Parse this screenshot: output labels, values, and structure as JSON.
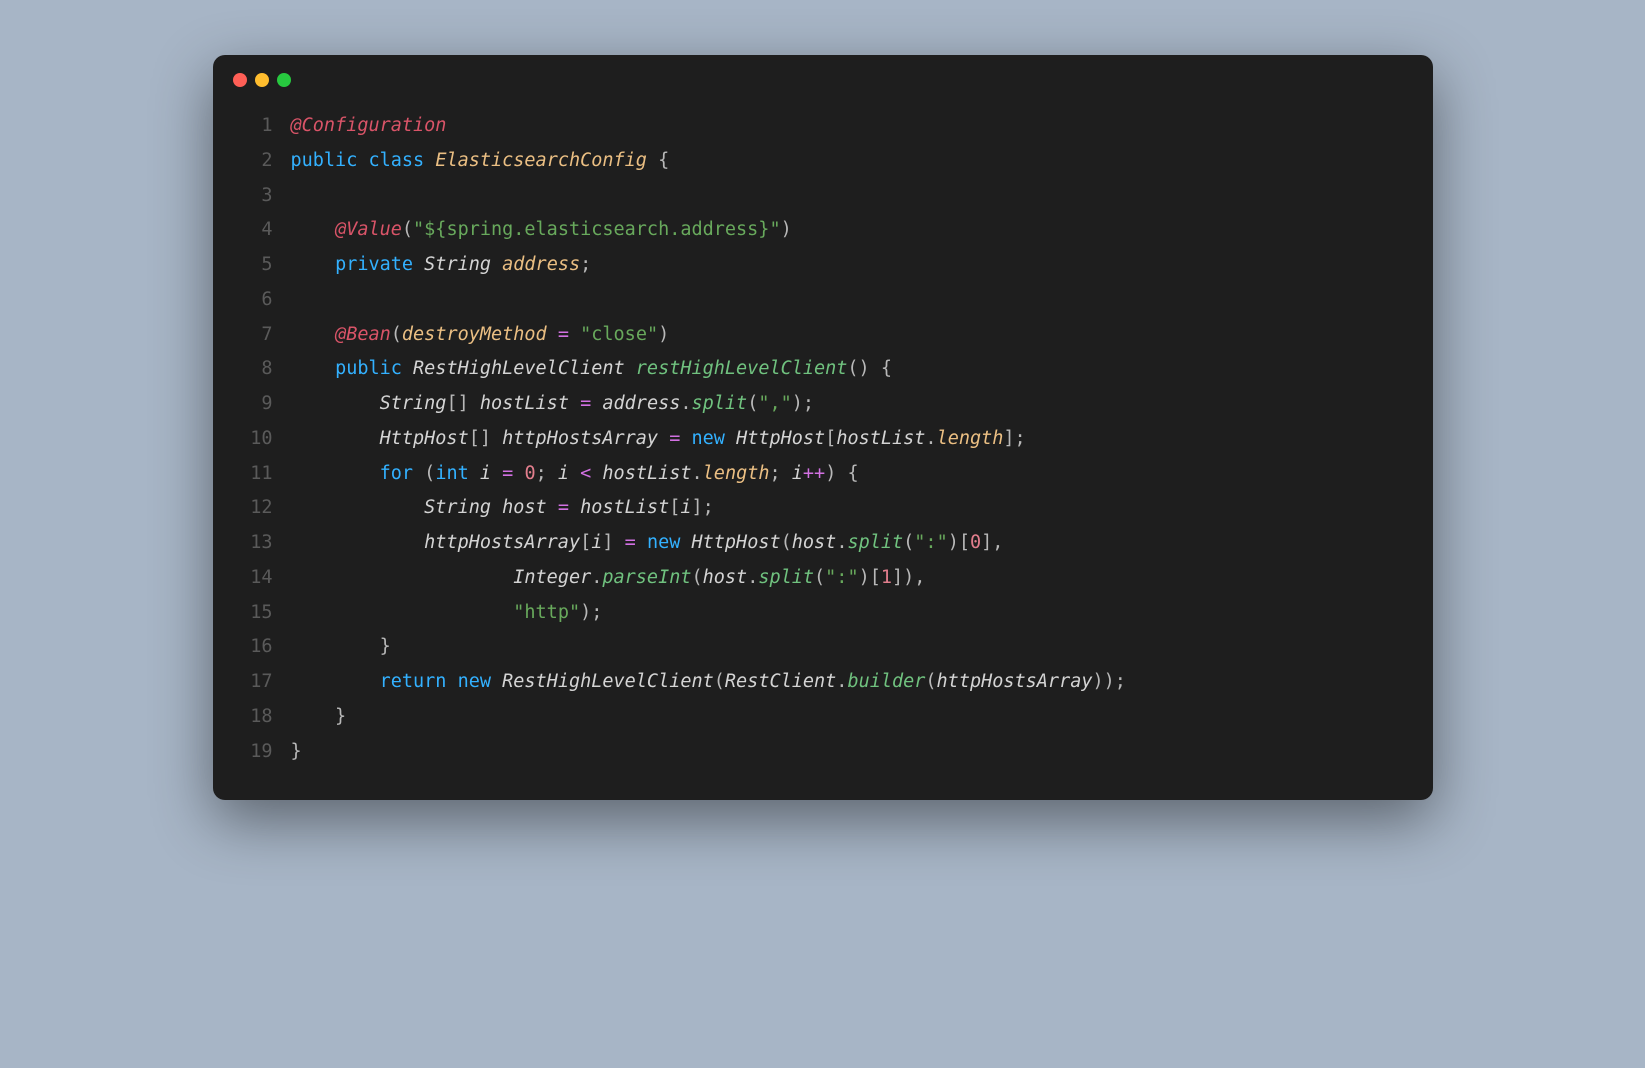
{
  "window": {
    "trafficLights": [
      "close",
      "minimize",
      "zoom"
    ]
  },
  "code": {
    "lineCount": 19,
    "lines": [
      [
        [
          "ann",
          "@Configuration"
        ]
      ],
      [
        [
          "kw",
          "public"
        ],
        [
          "punct",
          " "
        ],
        [
          "kw",
          "class"
        ],
        [
          "punct",
          " "
        ],
        [
          "classn",
          "ElasticsearchConfig"
        ],
        [
          "punct",
          " {"
        ]
      ],
      [],
      [
        [
          "punct",
          "    "
        ],
        [
          "ann",
          "@Value"
        ],
        [
          "punct",
          "("
        ],
        [
          "string",
          "\"${spring.elasticsearch.address}\""
        ],
        [
          "punct",
          ")"
        ]
      ],
      [
        [
          "punct",
          "    "
        ],
        [
          "kw",
          "private"
        ],
        [
          "punct",
          " "
        ],
        [
          "type",
          "String"
        ],
        [
          "punct",
          " "
        ],
        [
          "field",
          "address"
        ],
        [
          "punct",
          ";"
        ]
      ],
      [],
      [
        [
          "punct",
          "    "
        ],
        [
          "ann",
          "@Bean"
        ],
        [
          "punct",
          "("
        ],
        [
          "field",
          "destroyMethod"
        ],
        [
          "punct",
          " "
        ],
        [
          "op",
          "="
        ],
        [
          "punct",
          " "
        ],
        [
          "string",
          "\"close\""
        ],
        [
          "punct",
          ")"
        ]
      ],
      [
        [
          "punct",
          "    "
        ],
        [
          "kw",
          "public"
        ],
        [
          "punct",
          " "
        ],
        [
          "type",
          "RestHighLevelClient"
        ],
        [
          "punct",
          " "
        ],
        [
          "method",
          "restHighLevelClient"
        ],
        [
          "punct",
          "() {"
        ]
      ],
      [
        [
          "punct",
          "        "
        ],
        [
          "type",
          "String"
        ],
        [
          "punct",
          "[] "
        ],
        [
          "ident",
          "hostList"
        ],
        [
          "punct",
          " "
        ],
        [
          "op",
          "="
        ],
        [
          "punct",
          " "
        ],
        [
          "ident",
          "address"
        ],
        [
          "punct",
          "."
        ],
        [
          "method",
          "split"
        ],
        [
          "punct",
          "("
        ],
        [
          "string",
          "\",\""
        ],
        [
          "punct",
          ");"
        ]
      ],
      [
        [
          "punct",
          "        "
        ],
        [
          "type",
          "HttpHost"
        ],
        [
          "punct",
          "[] "
        ],
        [
          "ident",
          "httpHostsArray"
        ],
        [
          "punct",
          " "
        ],
        [
          "op",
          "="
        ],
        [
          "punct",
          " "
        ],
        [
          "kw",
          "new"
        ],
        [
          "punct",
          " "
        ],
        [
          "type",
          "HttpHost"
        ],
        [
          "punct",
          "["
        ],
        [
          "ident",
          "hostList"
        ],
        [
          "punct",
          "."
        ],
        [
          "field",
          "length"
        ],
        [
          "punct",
          "];"
        ]
      ],
      [
        [
          "punct",
          "        "
        ],
        [
          "kw",
          "for"
        ],
        [
          "punct",
          " ("
        ],
        [
          "kw",
          "int"
        ],
        [
          "punct",
          " "
        ],
        [
          "ident",
          "i"
        ],
        [
          "punct",
          " "
        ],
        [
          "op",
          "="
        ],
        [
          "punct",
          " "
        ],
        [
          "num",
          "0"
        ],
        [
          "punct",
          "; "
        ],
        [
          "ident",
          "i"
        ],
        [
          "punct",
          " "
        ],
        [
          "op",
          "<"
        ],
        [
          "punct",
          " "
        ],
        [
          "ident",
          "hostList"
        ],
        [
          "punct",
          "."
        ],
        [
          "field",
          "length"
        ],
        [
          "punct",
          "; "
        ],
        [
          "ident",
          "i"
        ],
        [
          "op",
          "++"
        ],
        [
          "punct",
          ") {"
        ]
      ],
      [
        [
          "punct",
          "            "
        ],
        [
          "type",
          "String"
        ],
        [
          "punct",
          " "
        ],
        [
          "ident",
          "host"
        ],
        [
          "punct",
          " "
        ],
        [
          "op",
          "="
        ],
        [
          "punct",
          " "
        ],
        [
          "ident",
          "hostList"
        ],
        [
          "punct",
          "["
        ],
        [
          "ident",
          "i"
        ],
        [
          "punct",
          "];"
        ]
      ],
      [
        [
          "punct",
          "            "
        ],
        [
          "ident",
          "httpHostsArray"
        ],
        [
          "punct",
          "["
        ],
        [
          "ident",
          "i"
        ],
        [
          "punct",
          "] "
        ],
        [
          "op",
          "="
        ],
        [
          "punct",
          " "
        ],
        [
          "kw",
          "new"
        ],
        [
          "punct",
          " "
        ],
        [
          "type",
          "HttpHost"
        ],
        [
          "punct",
          "("
        ],
        [
          "ident",
          "host"
        ],
        [
          "punct",
          "."
        ],
        [
          "method",
          "split"
        ],
        [
          "punct",
          "("
        ],
        [
          "string",
          "\":\""
        ],
        [
          "punct",
          ")["
        ],
        [
          "num",
          "0"
        ],
        [
          "punct",
          "],"
        ]
      ],
      [
        [
          "punct",
          "                    "
        ],
        [
          "type",
          "Integer"
        ],
        [
          "punct",
          "."
        ],
        [
          "method",
          "parseInt"
        ],
        [
          "punct",
          "("
        ],
        [
          "ident",
          "host"
        ],
        [
          "punct",
          "."
        ],
        [
          "method",
          "split"
        ],
        [
          "punct",
          "("
        ],
        [
          "string",
          "\":\""
        ],
        [
          "punct",
          ")["
        ],
        [
          "num",
          "1"
        ],
        [
          "punct",
          "]),"
        ]
      ],
      [
        [
          "punct",
          "                    "
        ],
        [
          "string",
          "\"http\""
        ],
        [
          "punct",
          ");"
        ]
      ],
      [
        [
          "punct",
          "        }"
        ]
      ],
      [
        [
          "punct",
          "        "
        ],
        [
          "kw",
          "return"
        ],
        [
          "punct",
          " "
        ],
        [
          "kw",
          "new"
        ],
        [
          "punct",
          " "
        ],
        [
          "type",
          "RestHighLevelClient"
        ],
        [
          "punct",
          "("
        ],
        [
          "type",
          "RestClient"
        ],
        [
          "punct",
          "."
        ],
        [
          "method",
          "builder"
        ],
        [
          "punct",
          "("
        ],
        [
          "ident",
          "httpHostsArray"
        ],
        [
          "punct",
          "));"
        ]
      ],
      [
        [
          "punct",
          "    }"
        ]
      ],
      [
        [
          "punct",
          "}"
        ]
      ]
    ]
  }
}
